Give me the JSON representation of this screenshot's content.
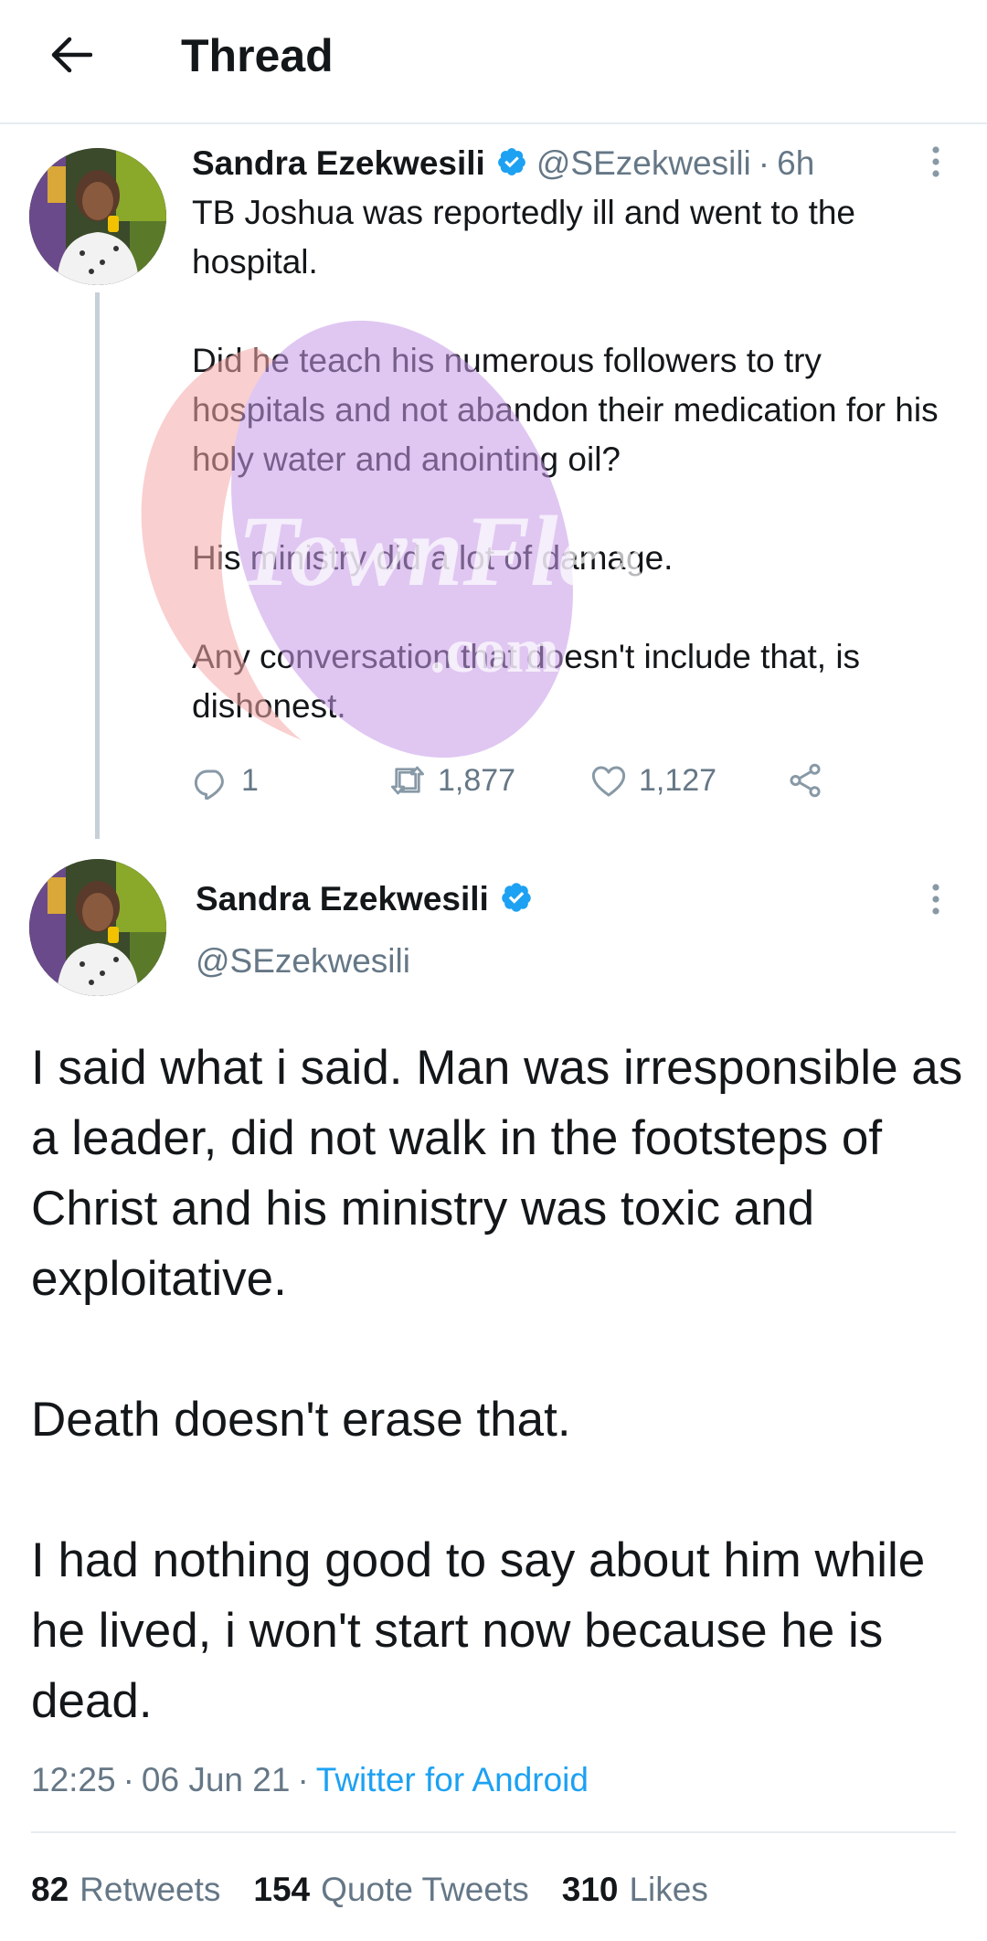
{
  "header": {
    "title": "Thread",
    "back_icon": "arrow-left-icon"
  },
  "tweet_parent": {
    "author_name": "Sandra Ezekwesili",
    "handle": "@SEzekwesili",
    "separator": "·",
    "time": "6h",
    "paragraphs": [
      "TB Joshua was reportedly ill and went to the hospital.",
      "Did he teach his numerous followers to try hospitals and not abandon their medication for his holy water and anointing oil?",
      "His ministry did a lot of damage.",
      "Any conversation that doesn't include that, is dishonest."
    ],
    "actions": {
      "reply_count": "1",
      "retweet_count": "1,877",
      "like_count": "1,127"
    }
  },
  "tweet_main": {
    "author_name": "Sandra Ezekwesili",
    "handle": "@SEzekwesili",
    "paragraphs": [
      "I said what i said. Man was irresponsible as a leader, did not walk in the footsteps of Christ and his ministry was toxic and exploitative.",
      "Death doesn't erase that.",
      "I had nothing good to say about him while he lived, i won't start now because he is dead."
    ],
    "time": "12:25",
    "date": "06 Jun 21",
    "separator": "·",
    "source": "Twitter for Android",
    "stats": {
      "retweets_count": "82",
      "retweets_label": "Retweets",
      "quotes_count": "154",
      "quotes_label": "Quote Tweets",
      "likes_count": "310",
      "likes_label": "Likes"
    }
  },
  "watermark": {
    "text_main": "TownFlex",
    "text_sub": ".com"
  },
  "colors": {
    "verified_blue": "#1da1f2",
    "secondary_text": "#657786",
    "primary_text": "#14171a",
    "link_blue": "#1da1f2",
    "watermark_purple": "#b98be0",
    "watermark_red": "#f26d6d"
  }
}
